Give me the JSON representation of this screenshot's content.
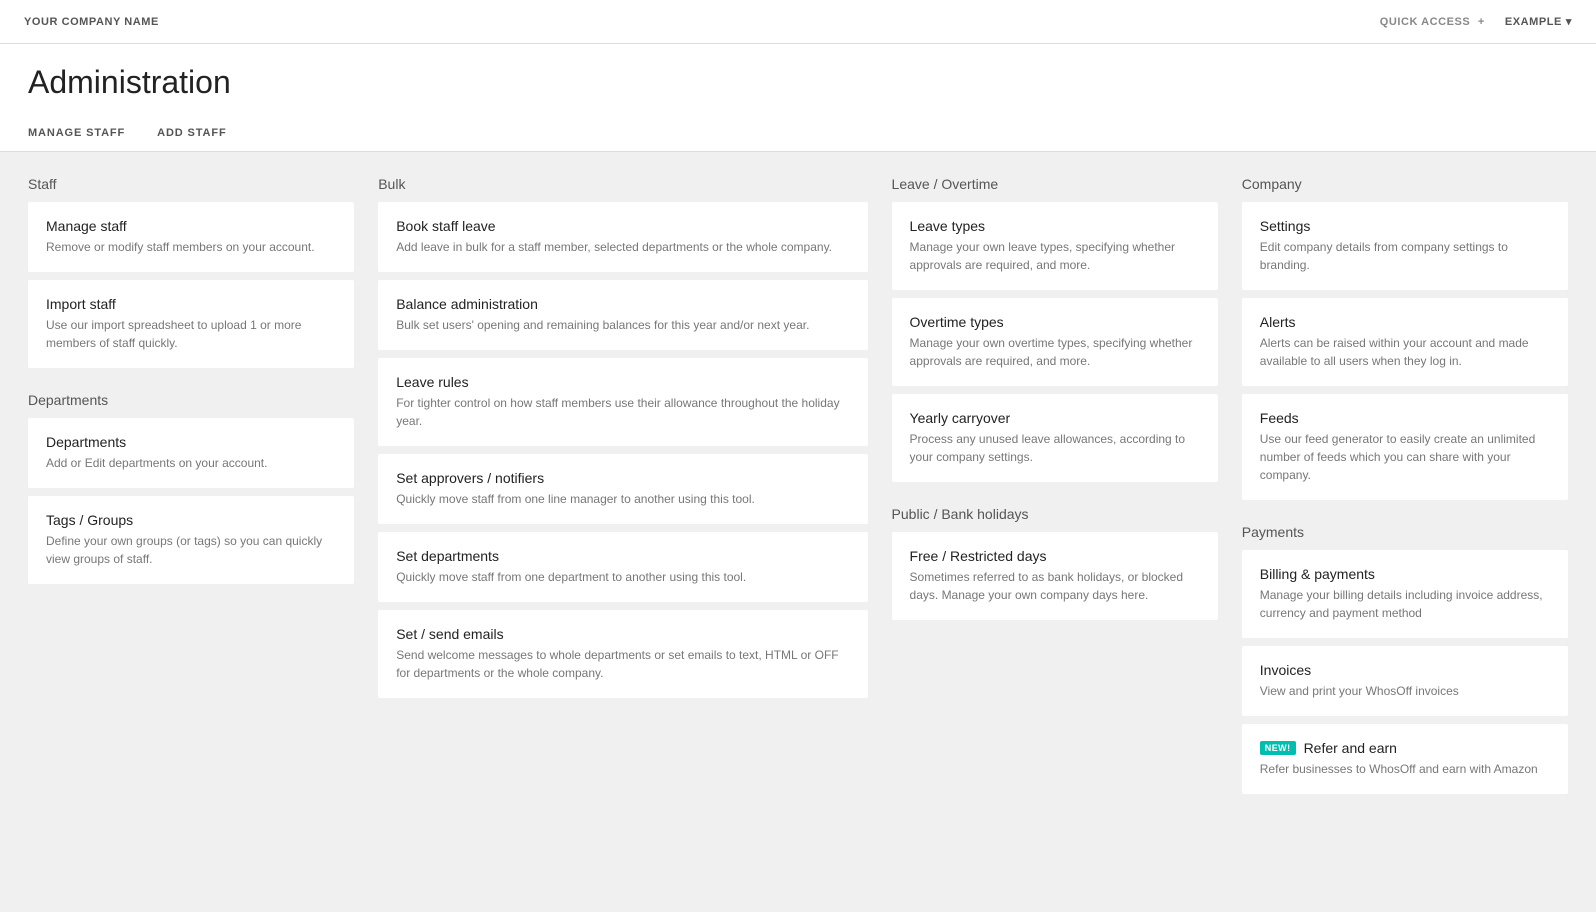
{
  "topnav": {
    "company_name": "YOUR COMPANY NAME",
    "quick_access_label": "QUICK ACCESS",
    "quick_access_icon": "+",
    "example_label": "EXAMPLE",
    "example_icon": "▾"
  },
  "header": {
    "title": "Administration",
    "tabs": [
      {
        "id": "manage-staff",
        "label": "MANAGE STAFF"
      },
      {
        "id": "add-staff",
        "label": "ADD STAFF"
      }
    ]
  },
  "columns": [
    {
      "id": "staff-col",
      "sections": [
        {
          "id": "staff-section",
          "title": "Staff",
          "cards": [
            {
              "id": "manage-staff-card",
              "title": "Manage staff",
              "desc": "Remove or modify staff members on your account."
            },
            {
              "id": "import-staff-card",
              "title": "Import staff",
              "desc": "Use our import spreadsheet to upload 1 or more members of staff quickly."
            }
          ]
        },
        {
          "id": "departments-section",
          "title": "Departments",
          "cards": [
            {
              "id": "departments-card",
              "title": "Departments",
              "desc": "Add or Edit departments on your account."
            },
            {
              "id": "tags-groups-card",
              "title": "Tags / Groups",
              "desc": "Define your own groups (or tags) so you can quickly view groups of staff."
            }
          ]
        }
      ]
    },
    {
      "id": "bulk-col",
      "sections": [
        {
          "id": "bulk-section",
          "title": "Bulk",
          "cards": [
            {
              "id": "book-staff-leave-card",
              "title": "Book staff leave",
              "desc": "Add leave in bulk for a staff member, selected departments or the whole company."
            },
            {
              "id": "balance-admin-card",
              "title": "Balance administration",
              "desc": "Bulk set users' opening and remaining balances for this year and/or next year."
            },
            {
              "id": "leave-rules-card",
              "title": "Leave rules",
              "desc": "For tighter control on how staff members use their allowance throughout the holiday year."
            },
            {
              "id": "set-approvers-card",
              "title": "Set approvers / notifiers",
              "desc": "Quickly move staff from one line manager to another using this tool."
            },
            {
              "id": "set-departments-card",
              "title": "Set departments",
              "desc": "Quickly move staff from one department to another using this tool."
            },
            {
              "id": "set-send-emails-card",
              "title": "Set / send emails",
              "desc": "Send welcome messages to whole departments or set emails to text, HTML or OFF for departments or the whole company."
            }
          ]
        }
      ]
    },
    {
      "id": "leave-overtime-col",
      "sections": [
        {
          "id": "leave-overtime-section",
          "title": "Leave / Overtime",
          "cards": [
            {
              "id": "leave-types-card",
              "title": "Leave types",
              "desc": "Manage your own leave types, specifying whether approvals are required, and more."
            },
            {
              "id": "overtime-types-card",
              "title": "Overtime types",
              "desc": "Manage your own overtime types, specifying whether approvals are required, and more."
            },
            {
              "id": "yearly-carryover-card",
              "title": "Yearly carryover",
              "desc": "Process any unused leave allowances, according to your company settings."
            }
          ]
        },
        {
          "id": "public-bank-section",
          "title": "Public / Bank holidays",
          "cards": [
            {
              "id": "free-restricted-card",
              "title": "Free / Restricted days",
              "desc": "Sometimes referred to as bank holidays, or blocked days. Manage your own company days here."
            }
          ]
        }
      ]
    },
    {
      "id": "company-col",
      "sections": [
        {
          "id": "company-section",
          "title": "Company",
          "cards": [
            {
              "id": "settings-card",
              "title": "Settings",
              "desc": "Edit company details from company settings to branding."
            },
            {
              "id": "alerts-card",
              "title": "Alerts",
              "desc": "Alerts can be raised within your account and made available to all users when they log in."
            },
            {
              "id": "feeds-card",
              "title": "Feeds",
              "desc": "Use our feed generator to easily create an unlimited number of feeds which you can share with your company."
            }
          ]
        },
        {
          "id": "payments-section",
          "title": "Payments",
          "cards": [
            {
              "id": "billing-payments-card",
              "title": "Billing & payments",
              "desc": "Manage your billing details including invoice address, currency and payment method"
            },
            {
              "id": "invoices-card",
              "title": "Invoices",
              "desc": "View and print your WhosOff invoices"
            },
            {
              "id": "refer-earn-card",
              "title": "Refer and earn",
              "badge": "New!",
              "desc": "Refer businesses to WhosOff and earn with Amazon"
            }
          ]
        }
      ]
    }
  ]
}
